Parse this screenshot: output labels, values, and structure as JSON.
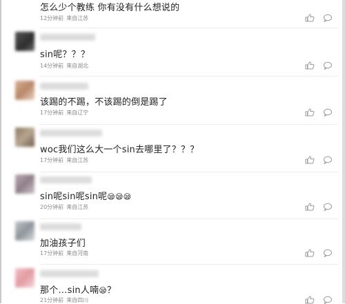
{
  "comments": [
    {
      "text": "怎么少个教练 你有没有什么想说的",
      "time": "12分钟前",
      "location": "来自江苏",
      "avatar_color": "#9aa3ab"
    },
    {
      "text": "sin呢？？？",
      "time": "14分钟前",
      "location": "来自湖北",
      "avatar_color": "#3b3b3b"
    },
    {
      "text": "该踢的不踢，不该踢的倒是踢了",
      "time": "17分钟前",
      "location": "来自辽宁",
      "avatar_color": "#c8a484"
    },
    {
      "text": "woc我们这么大一个sin去哪里了？？？",
      "time": "17分钟前",
      "location": "来自江苏",
      "avatar_color": "#8c7a64"
    },
    {
      "text": "sin呢sin呢sin呢",
      "time": "20分钟前",
      "location": "来自江苏",
      "avatar_color": "#a89aa4"
    },
    {
      "text": "加油孩子们",
      "time": "17分钟前",
      "location": "来自河南",
      "avatar_color": "#aab0b6"
    },
    {
      "text": "那个…sin人喃",
      "text_suffix": "？",
      "time": "21分钟前",
      "location": "来自四川",
      "avatar_color": "#e6b3b8"
    }
  ],
  "icons": {
    "like": "thumbs-up-icon",
    "reply": "comment-bubble-icon",
    "emoji": "sleepy-face-emoji"
  }
}
